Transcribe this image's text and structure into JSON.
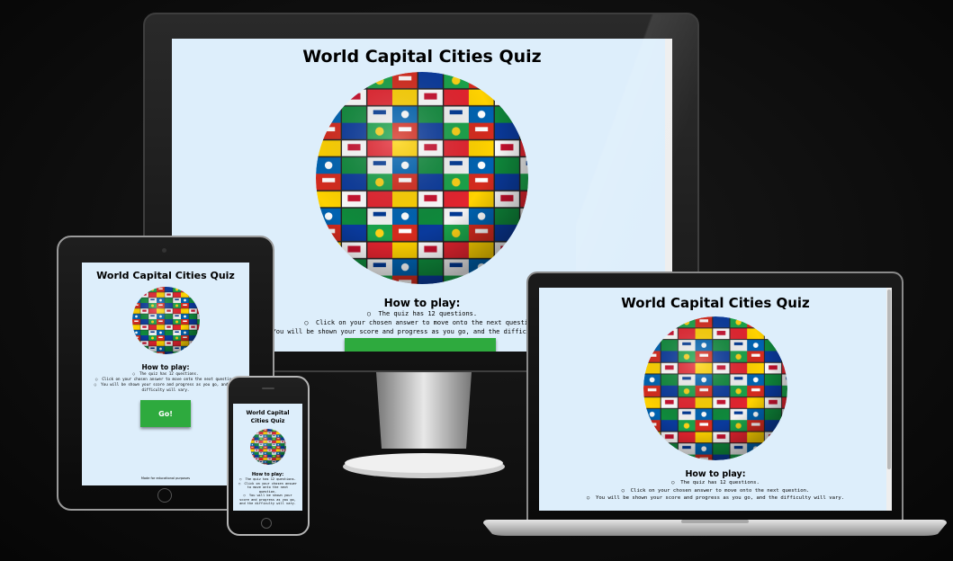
{
  "quiz": {
    "title": "World Capital Cities Quiz",
    "how_to_play": "How to play:",
    "rules": [
      "The quiz has 12 questions.",
      "Click on your chosen answer to move onto the next question.",
      "You will be shown your score and progress as you go, and the difficulty will vary."
    ],
    "go_label": "Go!",
    "footer": "Made for educational purposes"
  },
  "colors": {
    "screen_bg": "#ddeefb",
    "button_green": "#2eaa3e"
  },
  "icons": {
    "globe": "flag-globe-icon"
  }
}
